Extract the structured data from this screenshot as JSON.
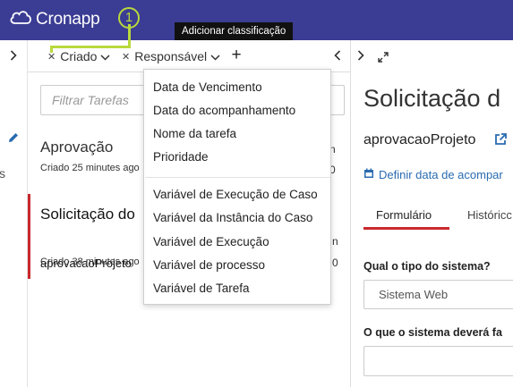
{
  "app": {
    "name": "Cronapp"
  },
  "annotation": {
    "badge_number": "1"
  },
  "filterbar": {
    "chips": [
      {
        "label": "Criado"
      },
      {
        "label": "Responsável"
      }
    ],
    "add_tooltip": "Adicionar classificação"
  },
  "tasklist": {
    "search_placeholder": "Filtrar Tarefas",
    "tasks": [
      {
        "title": "Aprovação",
        "process": "",
        "created": "Criado 25 minutes ago",
        "right_top": "n",
        "right_bottom": "0"
      },
      {
        "title": "Solicitação do",
        "process": "aprovacaoProjeto",
        "created": "Criado 38 minutes ago",
        "right_top": "n",
        "right_bottom": "0"
      }
    ]
  },
  "sort_menu": {
    "group1": [
      "Data de Vencimento",
      "Data do acompanhamento",
      "Nome da tarefa",
      "Prioridade"
    ],
    "group2": [
      "Variável de Execução de Caso",
      "Variável da Instância do Caso",
      "Variável de Execução",
      "Variável de processo",
      "Variável de Tarefa"
    ]
  },
  "detail": {
    "title": "Solicitação d",
    "process": "aprovacaoProjeto",
    "date_link": "Definir data de acompar",
    "tabs": [
      "Formulário",
      "Históricc"
    ],
    "question1": "Qual o tipo do sistema?",
    "question1_value": "Sistema Web",
    "question2": "O que o sistema deverá fa"
  },
  "leftnav": {
    "cut_text": "s"
  },
  "colors": {
    "topbar": "#3b3c93",
    "accent_red": "#c9282d",
    "annotation": "#b9d93d",
    "link": "#2a6bb0"
  }
}
